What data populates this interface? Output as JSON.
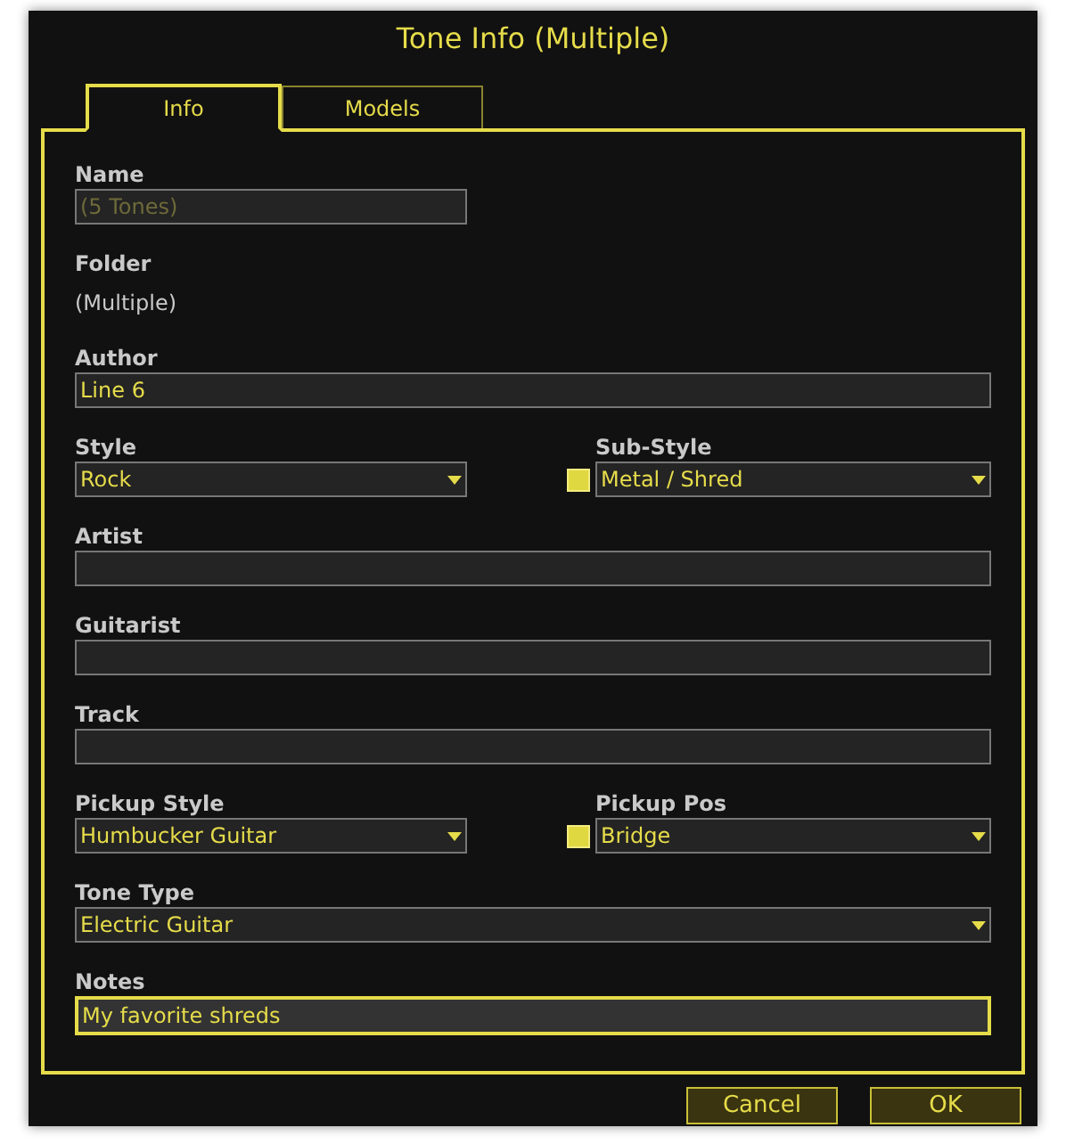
{
  "window": {
    "title": "Tone Info (Multiple)"
  },
  "tabs": [
    {
      "label": "Info",
      "selected": true
    },
    {
      "label": "Models",
      "selected": false
    }
  ],
  "rows": [
    [
      {
        "kind": "short_text",
        "label": "Name",
        "value": "(5 Tones)",
        "disabled": true
      }
    ],
    [
      {
        "kind": "static",
        "label": "Folder",
        "value": "(Multiple)"
      }
    ],
    [
      {
        "kind": "text",
        "label": "Author",
        "value": "Line 6"
      }
    ],
    [
      {
        "kind": "dropdown",
        "label": "Style",
        "value": "Rock"
      },
      {
        "kind": "dropdown",
        "label": "Sub-Style",
        "value": "Metal / Shred",
        "checked": true
      }
    ],
    [
      {
        "kind": "text",
        "label": "Artist"
      }
    ],
    [
      {
        "kind": "text",
        "label": "Guitarist"
      }
    ],
    [
      {
        "kind": "text",
        "label": "Track"
      }
    ],
    [
      {
        "kind": "dropdown",
        "label": "Pickup Style",
        "value": "Humbucker Guitar"
      },
      {
        "kind": "dropdown",
        "label": "Pickup Pos",
        "value": "Bridge",
        "checked": true
      }
    ],
    [
      {
        "kind": "dropdown",
        "label": "Tone Type",
        "value": "Electric Guitar"
      }
    ],
    [
      {
        "kind": "text",
        "label": "Notes",
        "value": "My favorite shreds",
        "focused": true
      }
    ]
  ],
  "buttons": [
    "Cancel",
    "OK"
  ]
}
